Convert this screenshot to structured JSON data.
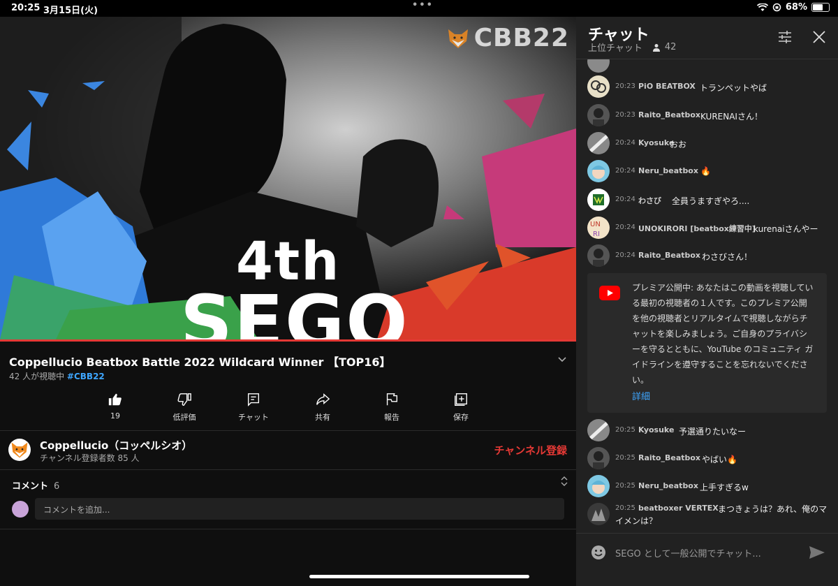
{
  "status": {
    "time": "20:25",
    "date": "3月15日(火)",
    "battery": "68%",
    "battery_level": 0.68
  },
  "video": {
    "logo_text": "CBB22",
    "overlay_rank": "4th",
    "overlay_name": "SEGO"
  },
  "info": {
    "title": "Coppellucio Beatbox Battle 2022 Wildcard Winner 【TOP16】",
    "viewers": "42 人が視聴中",
    "hashtag": "#CBB22",
    "actions": [
      {
        "label": "19",
        "icon": "thumbs-up-icon"
      },
      {
        "label": "低評価",
        "icon": "thumbs-down-icon"
      },
      {
        "label": "チャット",
        "icon": "chat-icon"
      },
      {
        "label": "共有",
        "icon": "share-icon"
      },
      {
        "label": "報告",
        "icon": "flag-icon"
      },
      {
        "label": "保存",
        "icon": "save-icon"
      }
    ]
  },
  "channel": {
    "name": "Coppellucio（コッペルシオ）",
    "subscribers": "チャンネル登録者数 85 人",
    "subscribe_label": "チャンネル登録"
  },
  "comments": {
    "label": "コメント",
    "count": "6",
    "placeholder": "コメントを追加..."
  },
  "chat": {
    "title": "チャット",
    "mode": "上位チャット",
    "viewer_count": "42",
    "messages": [
      {
        "time": "20:23",
        "author": "PiO BEATBOX",
        "text": "トランペットやば"
      },
      {
        "time": "20:23",
        "author": "Raito_Beatbox",
        "text": "KURENAIさん！"
      },
      {
        "time": "20:24",
        "author": "Kyosuke",
        "text": "おお"
      },
      {
        "time": "20:24",
        "author": "Neru_beatbox",
        "text": "🔥"
      },
      {
        "time": "20:24",
        "author": "わさび",
        "text": "全員うますぎやろ...."
      },
      {
        "time": "20:24",
        "author": "UNOKIRORI [beatbox練習中]",
        "text": "kurenaiさんやー"
      },
      {
        "time": "20:24",
        "author": "Raito_Beatbox",
        "text": "わさびさん！"
      },
      {
        "time": "20:25",
        "author": "Kyosuke",
        "text": "予選通りたいなー"
      },
      {
        "time": "20:25",
        "author": "Raito_Beatbox",
        "text": "やばい🔥"
      },
      {
        "time": "20:25",
        "author": "Neru_beatbox",
        "text": "上手すぎるw"
      }
    ],
    "last_message": {
      "time": "20:25",
      "author": "beatboxer VERTEX",
      "text_line1": "まつきょうは？あれ、俺のマ",
      "text_line2": "イメンは？"
    },
    "premiere": {
      "lines": [
        "プレミア公開中: あなたはこの動画を視聴してい",
        "る最初の視聴者の１人です。このプレミア公開",
        "を他の視聴者とリアルタイムで視聴しながらチ",
        "ャットを楽しみましょう。ご自身のプライバシ",
        "ーを守るとともに、YouTube のコミュニティ ガ",
        "イドラインを遵守することを忘れないでくださ",
        "い。"
      ],
      "link": "詳細"
    },
    "input_placeholder": "SEGO として一般公開でチャット..."
  },
  "colors": {
    "accent_red": "#e53935",
    "link_blue": "#3ea6ff",
    "background": "#0f0f0f",
    "chat_bg": "#212121"
  }
}
